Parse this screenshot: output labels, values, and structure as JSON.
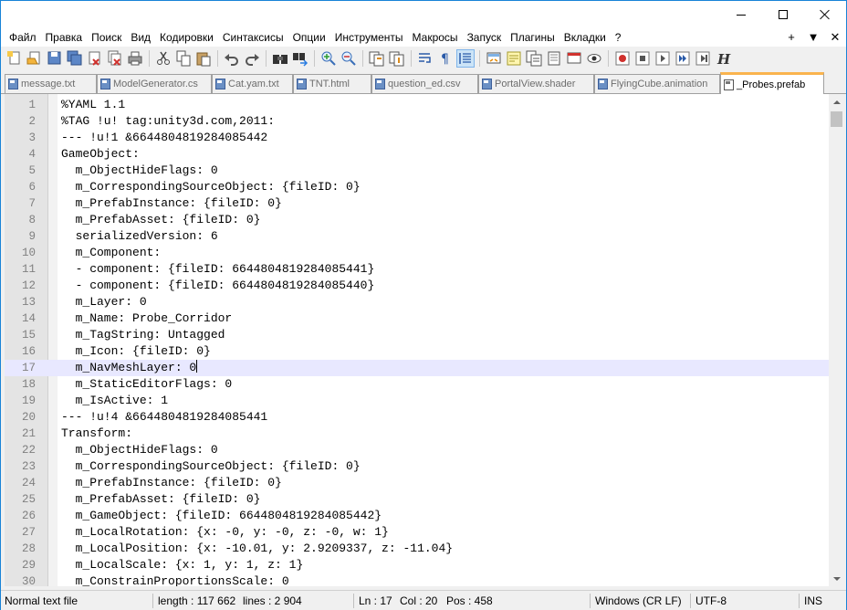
{
  "menu": {
    "items": [
      "Файл",
      "Правка",
      "Поиск",
      "Вид",
      "Кодировки",
      "Синтаксисы",
      "Опции",
      "Инструменты",
      "Макросы",
      "Запуск",
      "Плагины",
      "Вкладки",
      "?"
    ],
    "right": [
      "+",
      "▼",
      "✕"
    ]
  },
  "toolbar": {
    "icons": [
      "new-file-icon",
      "open-file-icon",
      "save-icon",
      "save-all-icon",
      "close-icon",
      "close-all-icon",
      "print-icon",
      "cut-icon",
      "copy-icon",
      "paste-icon",
      "undo-icon",
      "redo-icon",
      "find-icon",
      "replace-icon",
      "zoom-in-icon",
      "zoom-out-icon",
      "sync-v-icon",
      "sync-h-icon",
      "word-wrap-icon",
      "show-all-chars-icon",
      "indent-guide-icon",
      "doc-map-icon",
      "function-list-icon",
      "folder-workspace-icon",
      "doc-list-icon",
      "monitoring-icon",
      "record-macro-icon",
      "stop-record-icon",
      "play-macro-icon",
      "run-macro-multiple-icon",
      "save-macro-icon",
      "spell-check-icon"
    ]
  },
  "tabs": [
    {
      "label": "message.txt",
      "active": false
    },
    {
      "label": "ModelGenerator.cs",
      "active": false
    },
    {
      "label": "Cat.yam.txt",
      "active": false
    },
    {
      "label": "TNT.html",
      "active": false
    },
    {
      "label": "question_ed.csv",
      "active": false
    },
    {
      "label": "PortalView.shader",
      "active": false
    },
    {
      "label": "FlyingCube.animation",
      "active": false
    },
    {
      "label": "_Probes.prefab",
      "active": true
    }
  ],
  "editor": {
    "current_line": 17,
    "lines": [
      {
        "n": "1",
        "text": "%YAML 1.1"
      },
      {
        "n": "2",
        "text": "%TAG !u! tag:unity3d.com,2011:"
      },
      {
        "n": "3",
        "text": "--- !u!1 &6644804819284085442"
      },
      {
        "n": "4",
        "text": "GameObject:"
      },
      {
        "n": "5",
        "text": "  m_ObjectHideFlags: 0"
      },
      {
        "n": "6",
        "text": "  m_CorrespondingSourceObject: {fileID: 0}"
      },
      {
        "n": "7",
        "text": "  m_PrefabInstance: {fileID: 0}"
      },
      {
        "n": "8",
        "text": "  m_PrefabAsset: {fileID: 0}"
      },
      {
        "n": "9",
        "text": "  serializedVersion: 6"
      },
      {
        "n": "10",
        "text": "  m_Component:"
      },
      {
        "n": "11",
        "text": "  - component: {fileID: 6644804819284085441}"
      },
      {
        "n": "12",
        "text": "  - component: {fileID: 6644804819284085440}"
      },
      {
        "n": "13",
        "text": "  m_Layer: 0"
      },
      {
        "n": "14",
        "text": "  m_Name: Probe_Corridor"
      },
      {
        "n": "15",
        "text": "  m_TagString: Untagged"
      },
      {
        "n": "16",
        "text": "  m_Icon: {fileID: 0}"
      },
      {
        "n": "17",
        "text": "  m_NavMeshLayer: 0"
      },
      {
        "n": "18",
        "text": "  m_StaticEditorFlags: 0"
      },
      {
        "n": "19",
        "text": "  m_IsActive: 1"
      },
      {
        "n": "20",
        "text": "--- !u!4 &6644804819284085441"
      },
      {
        "n": "21",
        "text": "Transform:"
      },
      {
        "n": "22",
        "text": "  m_ObjectHideFlags: 0"
      },
      {
        "n": "23",
        "text": "  m_CorrespondingSourceObject: {fileID: 0}"
      },
      {
        "n": "24",
        "text": "  m_PrefabInstance: {fileID: 0}"
      },
      {
        "n": "25",
        "text": "  m_PrefabAsset: {fileID: 0}"
      },
      {
        "n": "26",
        "text": "  m_GameObject: {fileID: 6644804819284085442}"
      },
      {
        "n": "27",
        "text": "  m_LocalRotation: {x: -0, y: -0, z: -0, w: 1}"
      },
      {
        "n": "28",
        "text": "  m_LocalPosition: {x: -10.01, y: 2.9209337, z: -11.04}"
      },
      {
        "n": "29",
        "text": "  m_LocalScale: {x: 1, y: 1, z: 1}"
      },
      {
        "n": "30",
        "text": "  m_ConstrainProportionsScale: 0"
      }
    ]
  },
  "status": {
    "type": "Normal text file",
    "length": "length : 117 662",
    "lines": "lines : 2 904",
    "ln": "Ln : 17",
    "col": "Col : 20",
    "pos": "Pos : 458",
    "eol": "Windows (CR LF)",
    "encoding": "UTF-8",
    "mode": "INS"
  },
  "colors": {
    "accent_tab": "#fab44e",
    "current_line": "#e8e8ff",
    "window_border": "#1883d7"
  }
}
